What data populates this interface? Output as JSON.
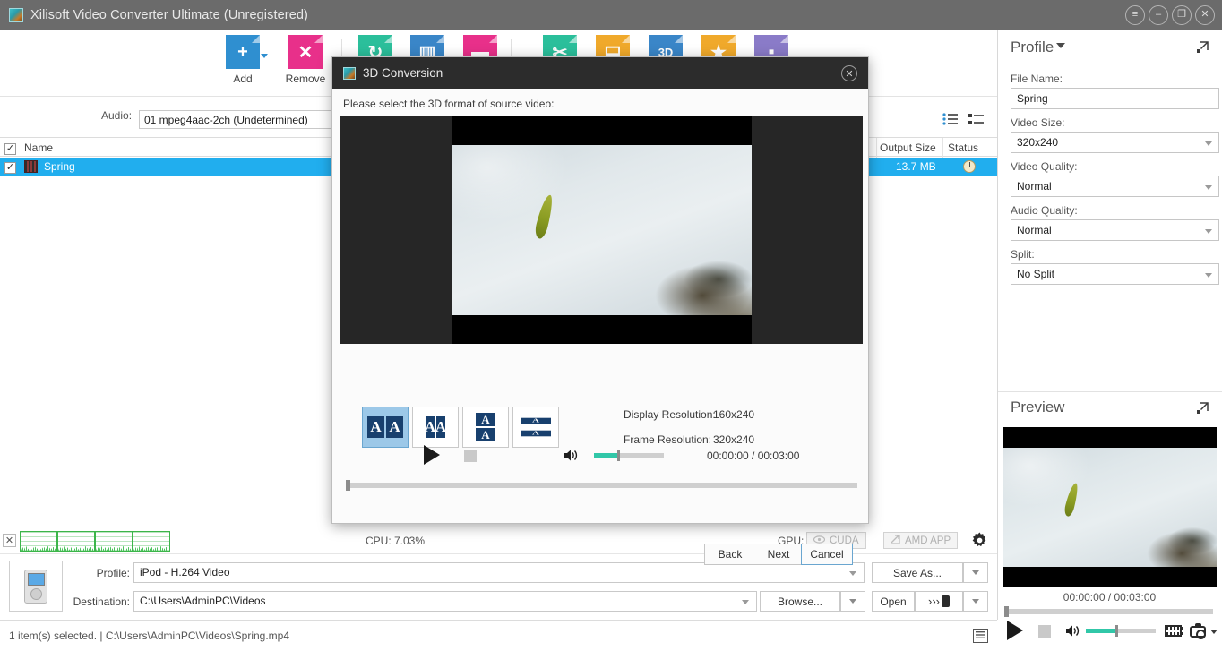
{
  "window": {
    "title": "Xilisoft Video Converter Ultimate (Unregistered)",
    "buttons": {
      "menu": "≡",
      "minimize": "–",
      "restore": "❐",
      "close": "✕"
    }
  },
  "toolbar": {
    "items": [
      {
        "name": "add",
        "label": "Add",
        "glyph": "+",
        "color": "#2f8fd0",
        "has_caret": true
      },
      {
        "name": "remove",
        "label": "Remove",
        "glyph": "✕",
        "color": "#e8308a",
        "has_caret": false
      },
      {
        "name": "convert",
        "label": "",
        "glyph": "↻",
        "color": "#2bbf9b",
        "has_caret": false
      },
      {
        "name": "merge",
        "label": "",
        "glyph": "▥",
        "color": "#3a86c8",
        "has_caret": false
      },
      {
        "name": "snapshot",
        "label": "",
        "glyph": "▬",
        "color": "#e8308a",
        "has_caret": false
      },
      {
        "name": "clip",
        "label": "",
        "glyph": "✂",
        "color": "#2bbf9b",
        "has_caret": false
      },
      {
        "name": "crop",
        "label": "",
        "glyph": "⬓",
        "color": "#f0a92b",
        "has_caret": false
      },
      {
        "name": "three-d",
        "label": "",
        "glyph": "3D",
        "color": "#3a86c8",
        "has_caret": false
      },
      {
        "name": "effect",
        "label": "",
        "glyph": "★",
        "color": "#f0a92b",
        "has_caret": false
      },
      {
        "name": "watermark",
        "label": "",
        "glyph": "▪",
        "color": "#8a7bc8",
        "has_caret": false
      }
    ]
  },
  "audio_row": {
    "label": "Audio:",
    "value": "01 mpeg4aac-2ch (Undetermined)"
  },
  "file_list": {
    "columns": [
      "Name",
      "Output Size",
      "Status"
    ],
    "header_checkbox": "✓",
    "rows": [
      {
        "checked": "✓",
        "name": "Spring",
        "output_size": "13.7 MB",
        "status_icon": "clock-icon"
      }
    ]
  },
  "profile_panel": {
    "title": "Profile",
    "expand_icon": "expand-icon",
    "fields": [
      {
        "label": "File Name:",
        "value": "Spring",
        "type": "input",
        "name": "file-name"
      },
      {
        "label": "Video Size:",
        "value": "320x240",
        "type": "select",
        "name": "video-size"
      },
      {
        "label": "Video Quality:",
        "value": "Normal",
        "type": "select",
        "name": "video-quality"
      },
      {
        "label": "Audio Quality:",
        "value": "Normal",
        "type": "select",
        "name": "audio-quality"
      },
      {
        "label": "Split:",
        "value": "No Split",
        "type": "select",
        "name": "split"
      }
    ]
  },
  "preview_panel": {
    "title": "Preview",
    "expand_icon": "expand-icon",
    "time": "00:00:00 / 00:03:00"
  },
  "cpu_bar": {
    "close_label": "✕",
    "cpu_text": "CPU: 7.03%",
    "gpu_label": "GPU:",
    "cuda_label": "CUDA",
    "amd_label": "AMD APP",
    "settings_icon": "gear-icon",
    "graph_count": 4
  },
  "bottom_bar": {
    "device_icon": "ipod-icon",
    "profile_label": "Profile:",
    "profile_value": "iPod - H.264 Video",
    "destination_label": "Destination:",
    "destination_value": "C:\\Users\\AdminPC\\Videos",
    "save_as_label": "Save As...",
    "browse_label": "Browse...",
    "open_label": "Open",
    "convert_label": "›››"
  },
  "status_bar": {
    "text": "1 item(s) selected. | C:\\Users\\AdminPC\\Videos\\Spring.mp4",
    "right_icon": "list-view-icon"
  },
  "dialog": {
    "title": "3D Conversion",
    "icon": "app-icon",
    "close_icon": "close-icon",
    "prompt": "Please select the 3D format of source video:",
    "formats": [
      {
        "name": "side-by-side",
        "selected": true,
        "layout": "horizontal",
        "glyph": "A"
      },
      {
        "name": "side-by-side-half",
        "selected": false,
        "layout": "horizontal-half",
        "glyph": "A"
      },
      {
        "name": "top-bottom",
        "selected": false,
        "layout": "vertical",
        "glyph": "A"
      },
      {
        "name": "top-bottom-anamorphic",
        "selected": false,
        "layout": "vertical-wide",
        "glyph": "A"
      }
    ],
    "info": [
      {
        "label": "Display Resolution:",
        "value": "160x240"
      },
      {
        "label": "Frame Resolution:",
        "value": "320x240"
      }
    ],
    "player": {
      "time": "00:00:00 / 00:03:00",
      "play_icon": "play-icon",
      "stop_icon": "stop-icon",
      "volume_icon": "volume-icon"
    },
    "buttons": [
      {
        "name": "back",
        "label": "Back",
        "focused": false
      },
      {
        "name": "next",
        "label": "Next",
        "focused": false
      },
      {
        "name": "cancel",
        "label": "Cancel",
        "focused": true
      }
    ]
  }
}
